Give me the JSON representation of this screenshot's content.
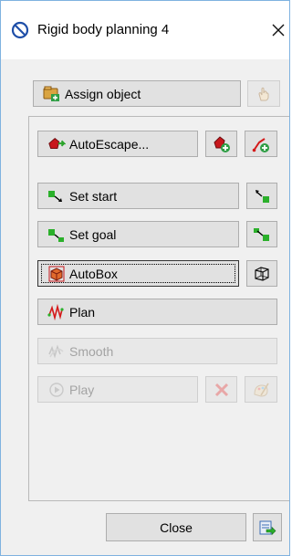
{
  "window": {
    "title": "Rigid body planning 4",
    "title_icon": "no-entry-icon",
    "close_icon": "close-icon"
  },
  "buttons": {
    "assign_object": {
      "label": "Assign object",
      "icon": "assign-object-icon",
      "enabled": true
    },
    "pick_object": {
      "icon": "hand-pointer-icon",
      "enabled": false
    },
    "autoescape": {
      "label": "AutoEscape...",
      "icon": "autoescape-icon",
      "enabled": true
    },
    "autoescape_add": {
      "icon": "add-escape-icon",
      "enabled": true
    },
    "escape_path_add": {
      "icon": "add-path-icon",
      "enabled": true
    },
    "set_start": {
      "label": "Set start",
      "icon": "set-start-icon",
      "enabled": true
    },
    "goto_start": {
      "icon": "goto-start-icon",
      "enabled": true
    },
    "set_goal": {
      "label": "Set goal",
      "icon": "set-goal-icon",
      "enabled": true
    },
    "goto_goal": {
      "icon": "goto-goal-icon",
      "enabled": true
    },
    "autobox": {
      "label": "AutoBox",
      "icon": "autobox-icon",
      "enabled": true,
      "focused": true
    },
    "box_wireframe": {
      "icon": "box-wireframe-icon",
      "enabled": true
    },
    "plan": {
      "label": "Plan",
      "icon": "plan-icon",
      "enabled": true
    },
    "smooth": {
      "label": "Smooth",
      "icon": "smooth-icon",
      "enabled": false
    },
    "play": {
      "label": "Play",
      "icon": "play-icon",
      "enabled": false
    },
    "delete_path": {
      "icon": "delete-icon",
      "enabled": false
    },
    "paint_path": {
      "icon": "paint-icon",
      "enabled": false
    },
    "close": {
      "label": "Close",
      "enabled": true
    },
    "export": {
      "icon": "export-icon",
      "enabled": true
    }
  },
  "colors": {
    "title_accent": "#1f4fa8",
    "window_border": "#7fb2e0",
    "button_face": "#e1e1e1",
    "dialog_bg": "#f0f0f0",
    "green_marker": "#2bb02b"
  }
}
